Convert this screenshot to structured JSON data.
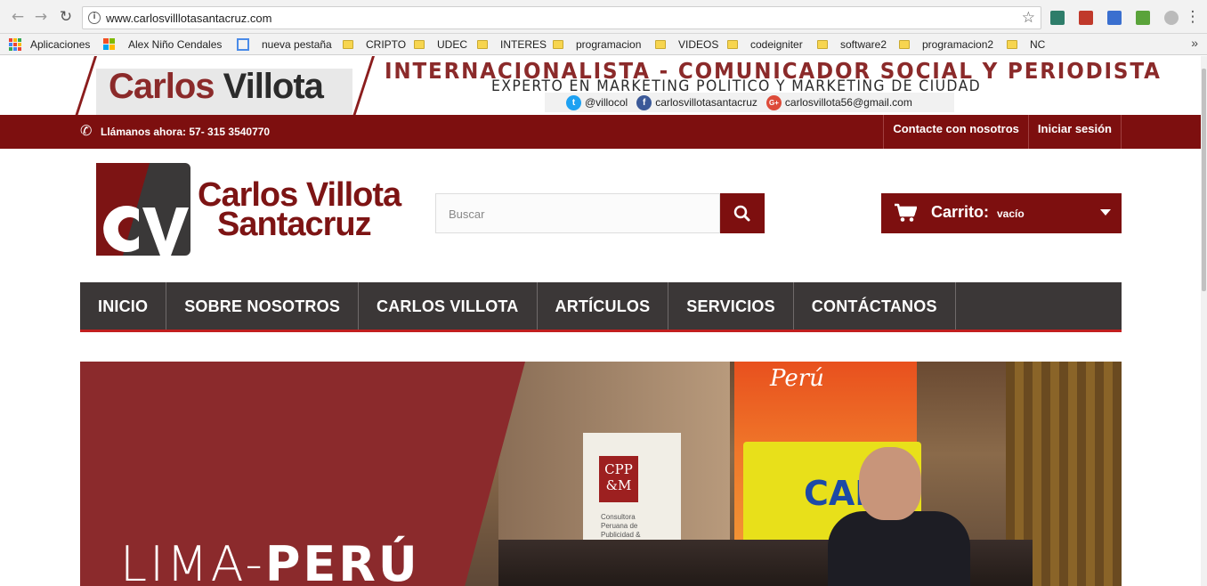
{
  "browser": {
    "url": "www.carlosvilllotasantacruz.com",
    "back_icon": "back-arrow-icon",
    "forward_icon": "forward-arrow-icon",
    "reload_icon": "reload-icon"
  },
  "bookmarks": {
    "apps_label": "Aplicaciones",
    "items": [
      {
        "label": "Alex Niño Cendales",
        "icon": "microsoft-icon"
      },
      {
        "label": "nueva pestaña",
        "icon": "page-icon"
      },
      {
        "label": "CRIPTO",
        "icon": "folder-icon"
      },
      {
        "label": "UDEC",
        "icon": "folder-icon"
      },
      {
        "label": "INTERES",
        "icon": "folder-icon"
      },
      {
        "label": "programacion",
        "icon": "folder-icon"
      },
      {
        "label": "VIDEOS",
        "icon": "folder-icon"
      },
      {
        "label": "codeigniter",
        "icon": "folder-icon"
      },
      {
        "label": "software2",
        "icon": "folder-icon"
      },
      {
        "label": "programacion2",
        "icon": "folder-icon"
      },
      {
        "label": "NC",
        "icon": "folder-icon"
      }
    ],
    "more": "»"
  },
  "banner": {
    "logo_first": "Carlos",
    "logo_last": "Villota",
    "headline": "INTERNACIONALISTA - COMUNICADOR SOCIAL Y PERIODISTA",
    "subheadline": "EXPERTO EN MARKETING POLITICO Y MARKETING DE CIUDAD",
    "socials": [
      {
        "handle": "@villocol",
        "color": "#1da1f2",
        "glyph": "t"
      },
      {
        "handle": "carlosvillotasantacruz",
        "color": "#3b5998",
        "glyph": "f"
      },
      {
        "handle": "carlosvillota56@gmail.com",
        "color": "#dd4b39",
        "glyph": "G+"
      }
    ]
  },
  "topbar": {
    "call_text": "Llámanos ahora: 57- 315 3540770",
    "contact_link": "Contacte con nosotros",
    "login_link": "Iniciar sesión"
  },
  "brand": {
    "line1": "Carlos Villota",
    "line2": "Santacruz"
  },
  "search": {
    "placeholder": "Buscar"
  },
  "cart": {
    "label": "Carrito:",
    "status": "vacío"
  },
  "menu": {
    "items": [
      "INICIO",
      "SOBRE NOSOTROS",
      "CARLOS VILLOTA",
      "ARTÍCULOS",
      "SERVICIOS",
      "CONTÁCTANOS"
    ]
  },
  "hero": {
    "city_light": "LIMA-",
    "city_bold": "PERÚ",
    "sign_peru": "Perú",
    "sign_logo": "CPP &M",
    "sign_small": "Consultora Peruana de Publicidad & Marketing",
    "sign_cade": "CADE"
  },
  "colors": {
    "brand_red": "#7d0f0f",
    "menu_dark": "#3b3737",
    "menu_accent": "#c21f1f",
    "hero_red": "#8b2a2c"
  }
}
